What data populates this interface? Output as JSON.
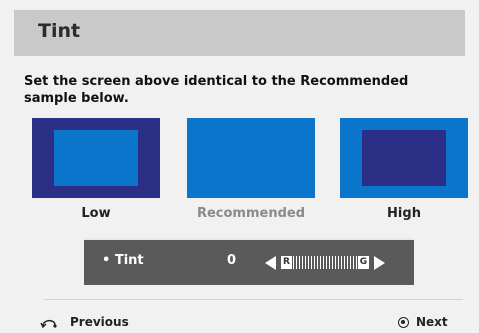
{
  "header": {
    "title": "Tint"
  },
  "instruction": "Set the screen above identical to the Recommended sample  below.",
  "samples": [
    {
      "label": "Low"
    },
    {
      "label": "Recommended"
    },
    {
      "label": "High"
    }
  ],
  "slider": {
    "bullet_label": "• Tint",
    "value": "0",
    "scale_left": "R",
    "scale_right": "G"
  },
  "footer": {
    "previous_label": "Previous",
    "next_label": "Next"
  },
  "colors": {
    "swatch_dark": "#2b2f86",
    "swatch_blue": "#0b74cb",
    "header_bg": "#c9c9c9",
    "slider_bg": "#5a5a5a"
  },
  "icons": {
    "previous": "return-arrow-icon",
    "next": "circle-dot-icon"
  }
}
